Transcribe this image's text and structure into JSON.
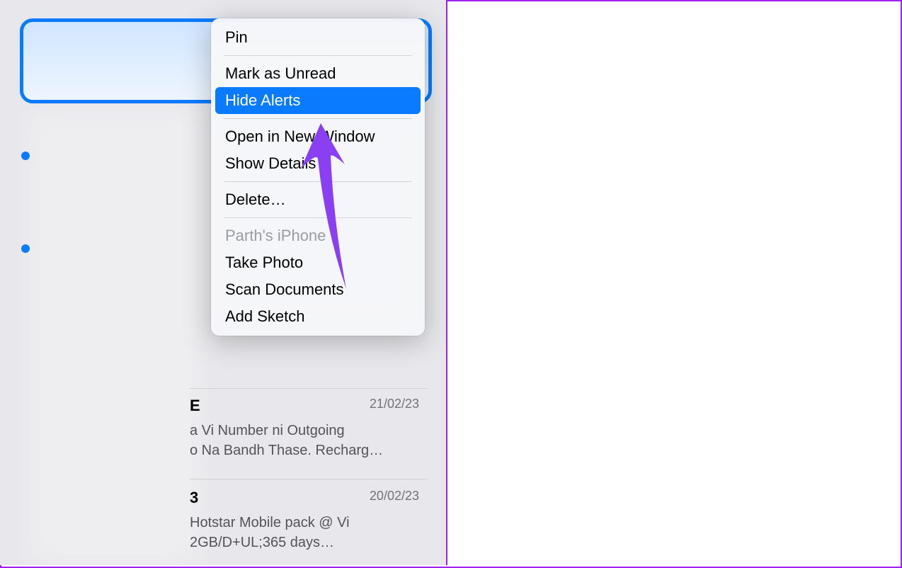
{
  "contextMenu": {
    "pin": "Pin",
    "markUnread": "Mark as Unread",
    "hideAlerts": "Hide Alerts",
    "openNewWindow": "Open in New Window",
    "showDetails": "Show Details",
    "delete": "Delete…",
    "deviceHeader": "Parth's iPhone",
    "takePhoto": "Take Photo",
    "scanDocuments": "Scan Documents",
    "addSketch": "Add Sketch"
  },
  "messages": [
    {
      "senderFragment": "E",
      "date": "21/02/23",
      "bodyLine1": "a Vi Number ni Outgoing",
      "bodyLine2": "o Na Bandh Thase. Recharg…"
    },
    {
      "senderFragment": "3",
      "date": "20/02/23",
      "bodyLine1": "Hotstar Mobile pack @ Vi",
      "bodyLine2": "2GB/D+UL;365 days…"
    }
  ]
}
